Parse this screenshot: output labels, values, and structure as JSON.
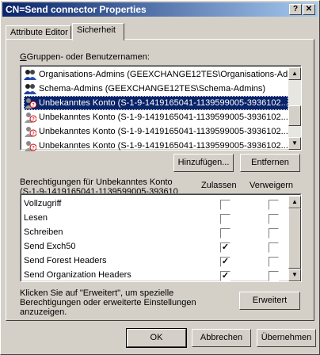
{
  "window": {
    "title": "CN=Send connector Properties",
    "help_btn": "?",
    "close_btn": "✕"
  },
  "tabs": [
    {
      "label": "Attribute Editor",
      "active": false
    },
    {
      "label": "Sicherheit",
      "active": true
    }
  ],
  "groups": {
    "label": "Gruppen- oder Benutzernamen:",
    "items": [
      {
        "name": "Organisations-Admins (GEEXCHANGE12TES\\Organisations-Ad...",
        "icon": "group-icon",
        "selected": false
      },
      {
        "name": "Schema-Admins (GEEXCHANGE12TES\\Schema-Admins)",
        "icon": "group-icon",
        "selected": false
      },
      {
        "name": "Unbekanntes Konto (S-1-9-1419165041-1139599005-3936102...",
        "icon": "unknown-user-icon",
        "selected": true
      },
      {
        "name": "Unbekanntes Konto (S-1-9-1419165041-1139599005-3936102...",
        "icon": "unknown-user-icon",
        "selected": false
      },
      {
        "name": "Unbekanntes Konto (S-1-9-1419165041-1139599005-3936102...",
        "icon": "unknown-user-icon",
        "selected": false
      },
      {
        "name": "Unbekanntes Konto (S-1-9-1419165041-1139599005-3936102...",
        "icon": "unknown-user-icon",
        "selected": false
      }
    ],
    "add_btn": "Hinzufügen...",
    "remove_btn": "Entfernen"
  },
  "permissions": {
    "label_line1": "Berechtigungen für Unbekanntes Konto",
    "label_line2": "(S-1-9-1419165041-1139599005-393610",
    "col_allow": "Zulassen",
    "col_deny": "Verweigern",
    "rows": [
      {
        "name": "Vollzugriff",
        "allow": false,
        "deny": false
      },
      {
        "name": "Lesen",
        "allow": false,
        "deny": false
      },
      {
        "name": "Schreiben",
        "allow": false,
        "deny": false
      },
      {
        "name": "Send Exch50",
        "allow": true,
        "deny": false
      },
      {
        "name": "Send Forest Headers",
        "allow": true,
        "deny": false
      },
      {
        "name": "Send Organization Headers",
        "allow": true,
        "deny": false
      }
    ]
  },
  "advanced": {
    "text_line1": "Klicken Sie auf \"Erweitert\", um spezielle",
    "text_line2": "Berechtigungen oder erweiterte Einstellungen",
    "text_line3": "anzuzeigen.",
    "btn": "Erweitert"
  },
  "footer": {
    "ok": "OK",
    "cancel": "Abbrechen",
    "apply": "Übernehmen"
  },
  "colors": {
    "titlebar": "#0a246a",
    "selection": "#0a246a",
    "face": "#d4d0c8"
  }
}
